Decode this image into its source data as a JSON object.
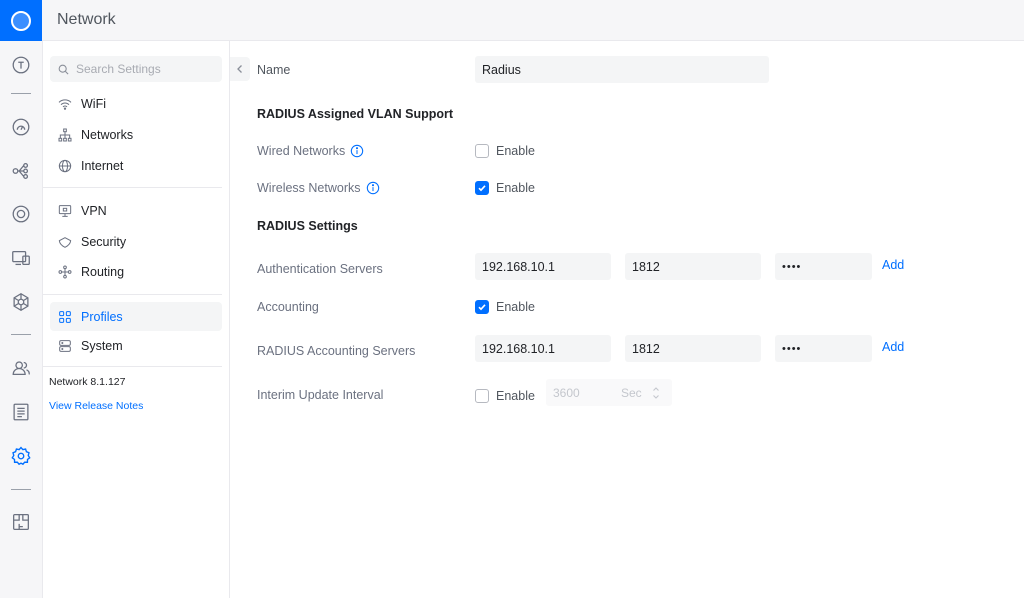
{
  "app": {
    "title": "Network"
  },
  "rail": {
    "icons": [
      "topology-icon",
      "dashboard-icon",
      "devices-icon",
      "clients-icon",
      "insights-icon",
      "hub-icon",
      "users-icon",
      "logs-icon",
      "settings-icon",
      "innerspace-icon"
    ],
    "active": "settings-icon"
  },
  "sidebar": {
    "search_placeholder": "Search Settings",
    "items": [
      {
        "label": "WiFi",
        "icon": "wifi-icon"
      },
      {
        "label": "Networks",
        "icon": "networks-icon"
      },
      {
        "label": "Internet",
        "icon": "globe-icon"
      },
      {
        "label": "VPN",
        "icon": "vpn-icon"
      },
      {
        "label": "Security",
        "icon": "shield-icon"
      },
      {
        "label": "Routing",
        "icon": "routing-icon"
      },
      {
        "label": "Profiles",
        "icon": "profiles-icon",
        "active": true
      },
      {
        "label": "System",
        "icon": "system-icon"
      }
    ],
    "version": "Network 8.1.127",
    "release_notes": "View Release Notes"
  },
  "form": {
    "name_label": "Name",
    "name_value": "Radius",
    "vlan_section": "RADIUS Assigned VLAN Support",
    "wired_label": "Wired Networks",
    "wired_enable": "Enable",
    "wired_checked": false,
    "wireless_label": "Wireless Networks",
    "wireless_enable": "Enable",
    "wireless_checked": true,
    "settings_section": "RADIUS Settings",
    "auth_label": "Authentication Servers",
    "auth_ip": "192.168.10.1",
    "auth_port": "1812",
    "auth_secret": "••••",
    "auth_add": "Add",
    "accounting_label": "Accounting",
    "accounting_enable": "Enable",
    "accounting_checked": true,
    "acct_label": "RADIUS Accounting Servers",
    "acct_ip": "192.168.10.1",
    "acct_port": "1812",
    "acct_secret": "••••",
    "acct_add": "Add",
    "interim_label": "Interim Update Interval",
    "interim_enable": "Enable",
    "interim_checked": false,
    "interim_value": "3600",
    "interim_unit": "Sec"
  },
  "colors": {
    "accent": "#006fff",
    "text": "#212327",
    "muted": "#6b7180",
    "field": "#f4f5f6"
  }
}
